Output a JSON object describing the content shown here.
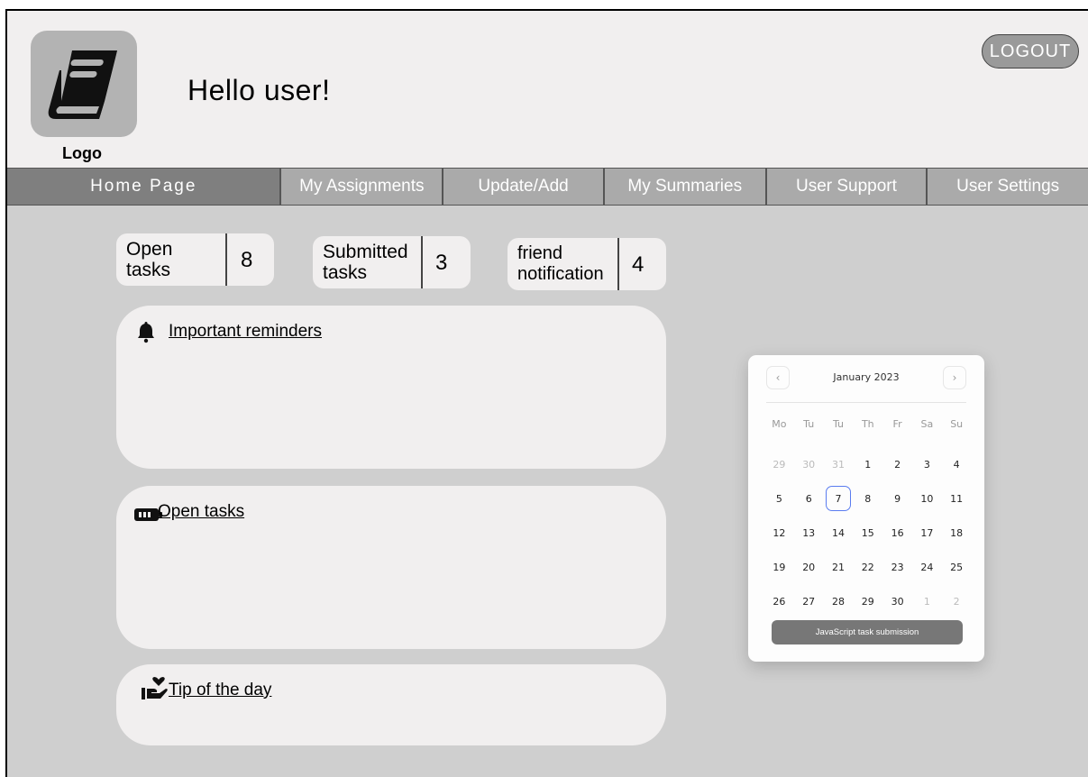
{
  "header": {
    "logo_label": "Logo",
    "greeting": "Hello user!",
    "logout_label": "LOGOUT"
  },
  "nav": {
    "items": [
      {
        "label": "Home Page",
        "active": true
      },
      {
        "label": "My Assignments",
        "active": false
      },
      {
        "label": "Update/Add",
        "active": false
      },
      {
        "label": "My Summaries",
        "active": false
      },
      {
        "label": "User Support",
        "active": false
      },
      {
        "label": "User Settings",
        "active": false
      }
    ]
  },
  "stats": {
    "open": {
      "label_line1": "Open",
      "label_line2": "tasks",
      "value": "8"
    },
    "submitted": {
      "label_line1": "Submitted",
      "label_line2": "tasks",
      "value": "3"
    },
    "friends": {
      "label_line1": "friend",
      "label_line2": "notification",
      "value": "4"
    }
  },
  "cards": {
    "reminders": {
      "title": "Important reminders",
      "icon": "bell-icon"
    },
    "open_tasks": {
      "title": "Open tasks",
      "icon": "battery-icon"
    },
    "tip": {
      "title": "Tip of the day",
      "icon": "hand-heart-icon"
    }
  },
  "calendar": {
    "month_label": "January 2023",
    "prev_icon": "chevron-left-icon",
    "next_icon": "chevron-right-icon",
    "weekdays": [
      "Mo",
      "Tu",
      "Tu",
      "Th",
      "Fr",
      "Sa",
      "Su"
    ],
    "weeks": [
      [
        "29",
        "30",
        "31",
        "1",
        "2",
        "3",
        "4"
      ],
      [
        "5",
        "6",
        "7",
        "8",
        "9",
        "10",
        "11"
      ],
      [
        "12",
        "13",
        "14",
        "15",
        "16",
        "17",
        "18"
      ],
      [
        "19",
        "20",
        "21",
        "22",
        "23",
        "24",
        "25"
      ],
      [
        "26",
        "27",
        "28",
        "29",
        "30",
        "1",
        "2"
      ]
    ],
    "selected_day": "7",
    "event_button": "JavaScript task submission"
  },
  "colors": {
    "panel": "#f1efef",
    "background": "#cfcfcf",
    "nav": "#aaaaaa",
    "nav_active": "#7f7f7f",
    "calendar_highlight": "#5a7cf0"
  }
}
